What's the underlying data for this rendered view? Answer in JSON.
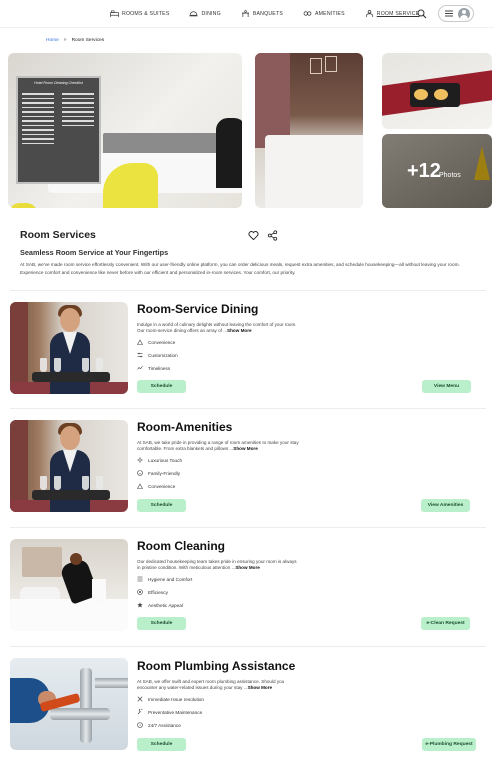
{
  "nav": {
    "items": [
      {
        "label": "ROOMS & SUITES",
        "icon": "bed-icon"
      },
      {
        "label": "DINING",
        "icon": "dish-icon"
      },
      {
        "label": "BANQUETS",
        "icon": "banquet-icon"
      },
      {
        "label": "AMENITIES",
        "icon": "amenities-icon"
      },
      {
        "label": "ROOM SERVICE",
        "icon": "bellhop-icon"
      }
    ],
    "active": "ROOM SERVICE"
  },
  "breadcrumb": {
    "home": "Home",
    "separator": "»",
    "current": "Room Services"
  },
  "gallery": {
    "checklist_title": "Hotel Room Cleaning Checklist",
    "more_count": "+12",
    "more_label": "Photos"
  },
  "page": {
    "title": "Room Services",
    "subtitle": "Seamless Room Service at Your Fingertips",
    "intro": "At SAB, we've made room service effortlessly convenient. With our user-friendly online platform, you can order delicious meals, request extra amenities, and schedule housekeeping—all without leaving your room. Experience comfort and convenience like never before with our efficient and personalized in-room services. Your comfort, our priority."
  },
  "services": [
    {
      "title": "Room-Service Dining",
      "desc": "Indulge in a world of culinary delights without leaving the comfort of your room. Our room-service dining offers an array of ...",
      "more": "Show More",
      "features": [
        {
          "label": "Convenience",
          "icon": "convenience-icon"
        },
        {
          "label": "Customization",
          "icon": "customization-icon"
        },
        {
          "label": "Timeliness",
          "icon": "timeliness-icon"
        }
      ],
      "schedule": "Schedule",
      "action": "View Menu"
    },
    {
      "title": "Room-Amenities",
      "desc": "At SAB, we take pride in providing a range of room amenities to make your stay comfortable. From extra blankets and pillows ...",
      "more": "Show More",
      "features": [
        {
          "label": "Luxurious Touch",
          "icon": "sparkle-icon"
        },
        {
          "label": "Family-Friendly",
          "icon": "smile-icon"
        },
        {
          "label": "Convenience",
          "icon": "convenience-icon"
        }
      ],
      "schedule": "Schedule",
      "action": "View Amenities"
    },
    {
      "title": "Room Cleaning",
      "desc": "Our dedicated housekeeping team takes pride in ensuring your room is always in pristine condition. With meticulous attention ...",
      "more": "Show More",
      "features": [
        {
          "label": "Hygiene and Comfort",
          "icon": "list-icon"
        },
        {
          "label": "Efficiency",
          "icon": "target-icon"
        },
        {
          "label": "Aesthetic Appeal",
          "icon": "star-icon"
        }
      ],
      "schedule": "Schedule",
      "action": "e-Clean Request"
    },
    {
      "title": "Room Plumbing Assistance",
      "desc": "At SAB, we offer swift and expert room plumbing assistance. Should you encounter any water-related issues during your stay ...",
      "more": "Show More",
      "features": [
        {
          "label": "Immediate Issue resolution",
          "icon": "tools-icon"
        },
        {
          "label": "Preventative Maintenance",
          "icon": "wrench-icon"
        },
        {
          "label": "24/7 Assistance",
          "icon": "clock-icon"
        }
      ],
      "schedule": "Schedule",
      "action": "e-Plumbing Request"
    }
  ],
  "colors": {
    "button_bg": "#b9efcb",
    "link": "#2f6fde"
  }
}
